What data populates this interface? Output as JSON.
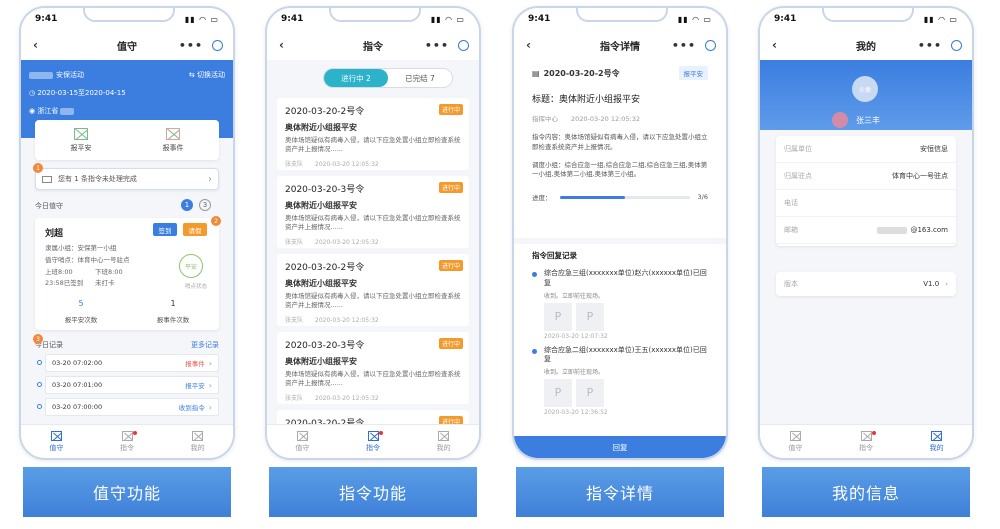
{
  "status": {
    "time": "9:41"
  },
  "tabbar": {
    "tab1": "值守",
    "tab2": "指令",
    "tab3": "我的"
  },
  "captions": [
    "值守功能",
    "指令功能",
    "指令详情",
    "我的信息"
  ],
  "phone1": {
    "title": "值守",
    "activity": "安保活动",
    "switch_label": "切换活动",
    "date_range": "2020-03-15至2020-04-15",
    "location": "浙江省",
    "quick_actions": [
      "报平安",
      "报事件"
    ],
    "notice": "您有 1 条指令未处理完成",
    "today_duty_label": "今日值守",
    "pages": [
      "1",
      "3"
    ],
    "duty": {
      "name": "刘超",
      "sign_btn": "签到",
      "leave_btn": "请假",
      "group": "隶属小组：安保第一小组",
      "post": "值守哨点：体育中心一号驻点",
      "on_time": "上班8:00",
      "off_time": "下班8:00",
      "not_punched": "23:58已签到",
      "unpunched": "未打卡",
      "ring_text": "平安",
      "ring_sub": "哨点状态",
      "stats": [
        {
          "value": "5",
          "label": "报平安次数"
        },
        {
          "value": "1",
          "label": "报事件次数"
        }
      ]
    },
    "records_title": "今日记录",
    "more_records": "更多记录",
    "records": [
      {
        "time": "03-20 07:02:00",
        "status": "报事件",
        "color": "#e85a4f"
      },
      {
        "time": "03-20 07:01:00",
        "status": "报平安",
        "color": "#3b7ee0"
      },
      {
        "time": "03-20 07:00:00",
        "status": "收到指令",
        "color": "#3b7ee0"
      }
    ],
    "badges": [
      "1",
      "2",
      "3"
    ]
  },
  "phone2": {
    "title": "指令",
    "seg_on": "进行中 2",
    "seg_off": "已完结 7",
    "orders": [
      {
        "no": "2020-03-20-2号令",
        "tag": "进行中",
        "subject": "奥体附近小组报平安",
        "desc": "奥体场馆疑似有病毒入侵，请以下应急处置小组立即检查系统资产并上报情况......",
        "meta": "张支队　　2020-03-20  12:05:32"
      },
      {
        "no": "2020-03-20-3号令",
        "tag": "进行中",
        "subject": "奥体附近小组报平安",
        "desc": "奥体场馆疑似有病毒入侵，请以下应急处置小组立即检查系统资产并上报情况......",
        "meta": "张支队　　2020-03-20  12:05:32"
      },
      {
        "no": "2020-03-20-2号令",
        "tag": "进行中",
        "subject": "奥体附近小组报平安",
        "desc": "奥体场馆疑似有病毒入侵，请以下应急处置小组立即检查系统资产并上报情况......",
        "meta": "张支队　　2020-03-20  12:05:32"
      },
      {
        "no": "2020-03-20-3号令",
        "tag": "进行中",
        "subject": "奥体附近小组报平安",
        "desc": "奥体场馆疑似有病毒入侵，请以下应急处置小组立即检查系统资产并上报情况......",
        "meta": "张支队　　2020-03-20  12:05:32"
      },
      {
        "no": "2020-03-20-2号令",
        "tag": "进行中",
        "subject": "",
        "desc": "",
        "meta": ""
      }
    ]
  },
  "phone3": {
    "title": "指令详情",
    "order_no": "2020-03-20-2号令",
    "pill": "报平安",
    "heading": "标题：奥体附近小组报平安",
    "meta": "指挥中心　　2020-03-20 12:05:32",
    "content": "指令内容：奥体场馆疑似有病毒入侵，请以下应急处置小组立即检查系统资产并上报情况。",
    "dispatch": "调度小组：综合应急一组,综合应急二组,综合应急三组,奥体第一小组,奥体第二小组,奥体第三小组。",
    "progress_label": "进度：",
    "progress_value": 0.5,
    "progress_text": "3/6",
    "reply_title": "指令回复记录",
    "replies": [
      {
        "name": "综合应急三组(xxxxxxx单位)赵六(xxxxxx单位)已回复",
        "sub": "收到。立即前往现场。",
        "time": "2020-03-20 12:07:32"
      },
      {
        "name": "综合应急二组(xxxxxxx单位)王五(xxxxxx单位)已回复",
        "sub": "收到。立即前往现场。",
        "time": "2020-03-20 12:36:52"
      }
    ],
    "reply_btn": "回复"
  },
  "phone4": {
    "title": "我的",
    "avatar_text": "头像",
    "name": "张三丰",
    "rows": [
      {
        "k": "归属单位",
        "v": "安恒信息"
      },
      {
        "k": "归属驻点",
        "v": "体育中心一号驻点"
      },
      {
        "k": "电话",
        "v": ""
      },
      {
        "k": "邮箱",
        "v": "@163.com"
      }
    ],
    "version_label": "版本",
    "version": "V1.0"
  }
}
